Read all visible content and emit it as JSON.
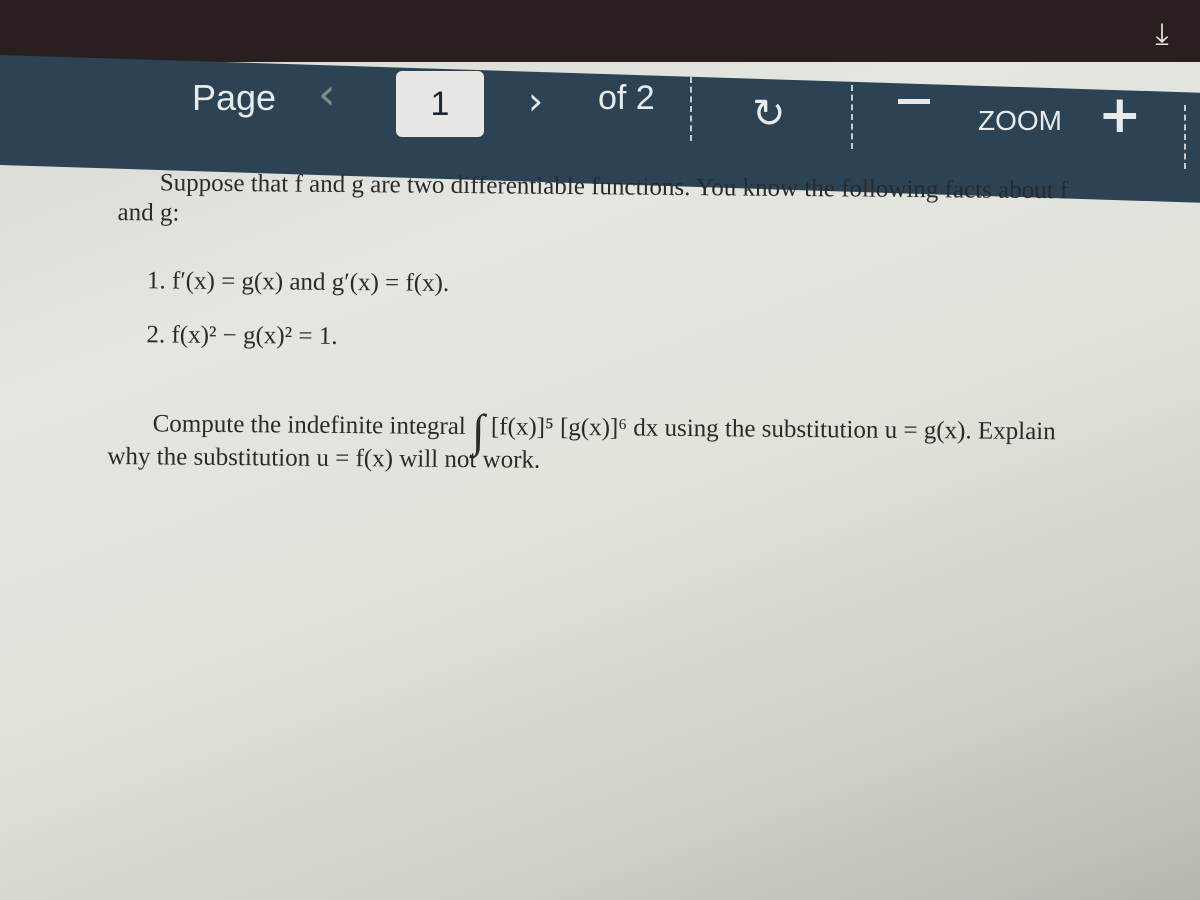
{
  "toolbar": {
    "page_label": "Page",
    "prev_icon": "chevron-left-icon",
    "prev_glyph": "‹",
    "current_page": "1",
    "next_icon": "chevron-right-icon",
    "next_glyph": "›",
    "of_label": "of 2",
    "rotate_icon": "rotate-icon",
    "rotate_glyph": "↻",
    "zoom_out_icon": "minus-icon",
    "zoom_label": "ZOOM",
    "zoom_in_icon": "plus-icon",
    "zoom_in_glyph": "+",
    "download_icon": "download-icon",
    "download_glyph": "⤓"
  },
  "colors": {
    "toolbar_bg": "#2c4356",
    "topbar_bg": "#2a1f1f",
    "toolbar_text": "#e9eaea",
    "page_input_bg": "#e9e7e3"
  },
  "document": {
    "intro_line1": "Suppose that f and g are two differentiable functions. You know the following facts about f",
    "intro_line2": "and g:",
    "fact1": "1.  f′(x) = g(x) and g′(x) = f(x).",
    "fact2": "2.  f(x)² − g(x)² = 1.",
    "question_prefix": "Compute the indefinite integral",
    "integral_symbol": "∫",
    "integrand": "[f(x)]⁵ [g(x)]⁶ dx",
    "question_suffix": "using the substitution u = g(x). Explain",
    "question_line2": "why the substitution u = f(x) will not work."
  }
}
